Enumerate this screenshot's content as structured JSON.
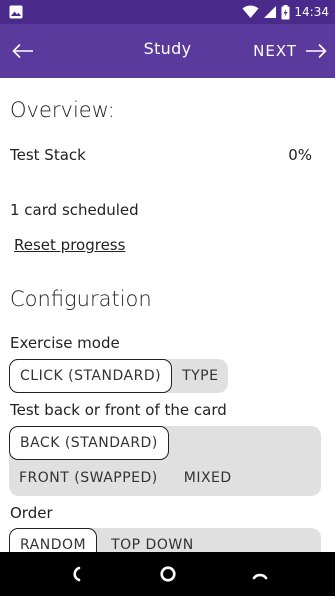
{
  "status_bar": {
    "time": "14:34",
    "icons": [
      "image-icon",
      "wifi-icon",
      "signal-icon",
      "battery-icon"
    ]
  },
  "app_bar": {
    "title": "Study",
    "next_label": "NEXT"
  },
  "overview": {
    "heading": "Overview:",
    "stack_name": "Test Stack",
    "progress": "0%",
    "scheduled": "1 card scheduled",
    "reset_label": "Reset progress"
  },
  "configuration": {
    "heading": "Configuration",
    "exercise_mode": {
      "label": "Exercise mode",
      "options": [
        "CLICK (STANDARD)",
        "TYPE"
      ],
      "selected": "CLICK (STANDARD)"
    },
    "side": {
      "label": "Test back or front of the card",
      "options": [
        "BACK (STANDARD)",
        "FRONT (SWAPPED)",
        "MIXED"
      ],
      "selected": "BACK (STANDARD)"
    },
    "order": {
      "label": "Order",
      "options": [
        "RANDOM",
        "TOP DOWN"
      ],
      "selected": "RANDOM"
    }
  },
  "colors": {
    "status_bar": "#4a2b8c",
    "app_bar": "#5a3a9d",
    "segment_bg": "#e0e0e0",
    "nav_bar": "#000000"
  }
}
